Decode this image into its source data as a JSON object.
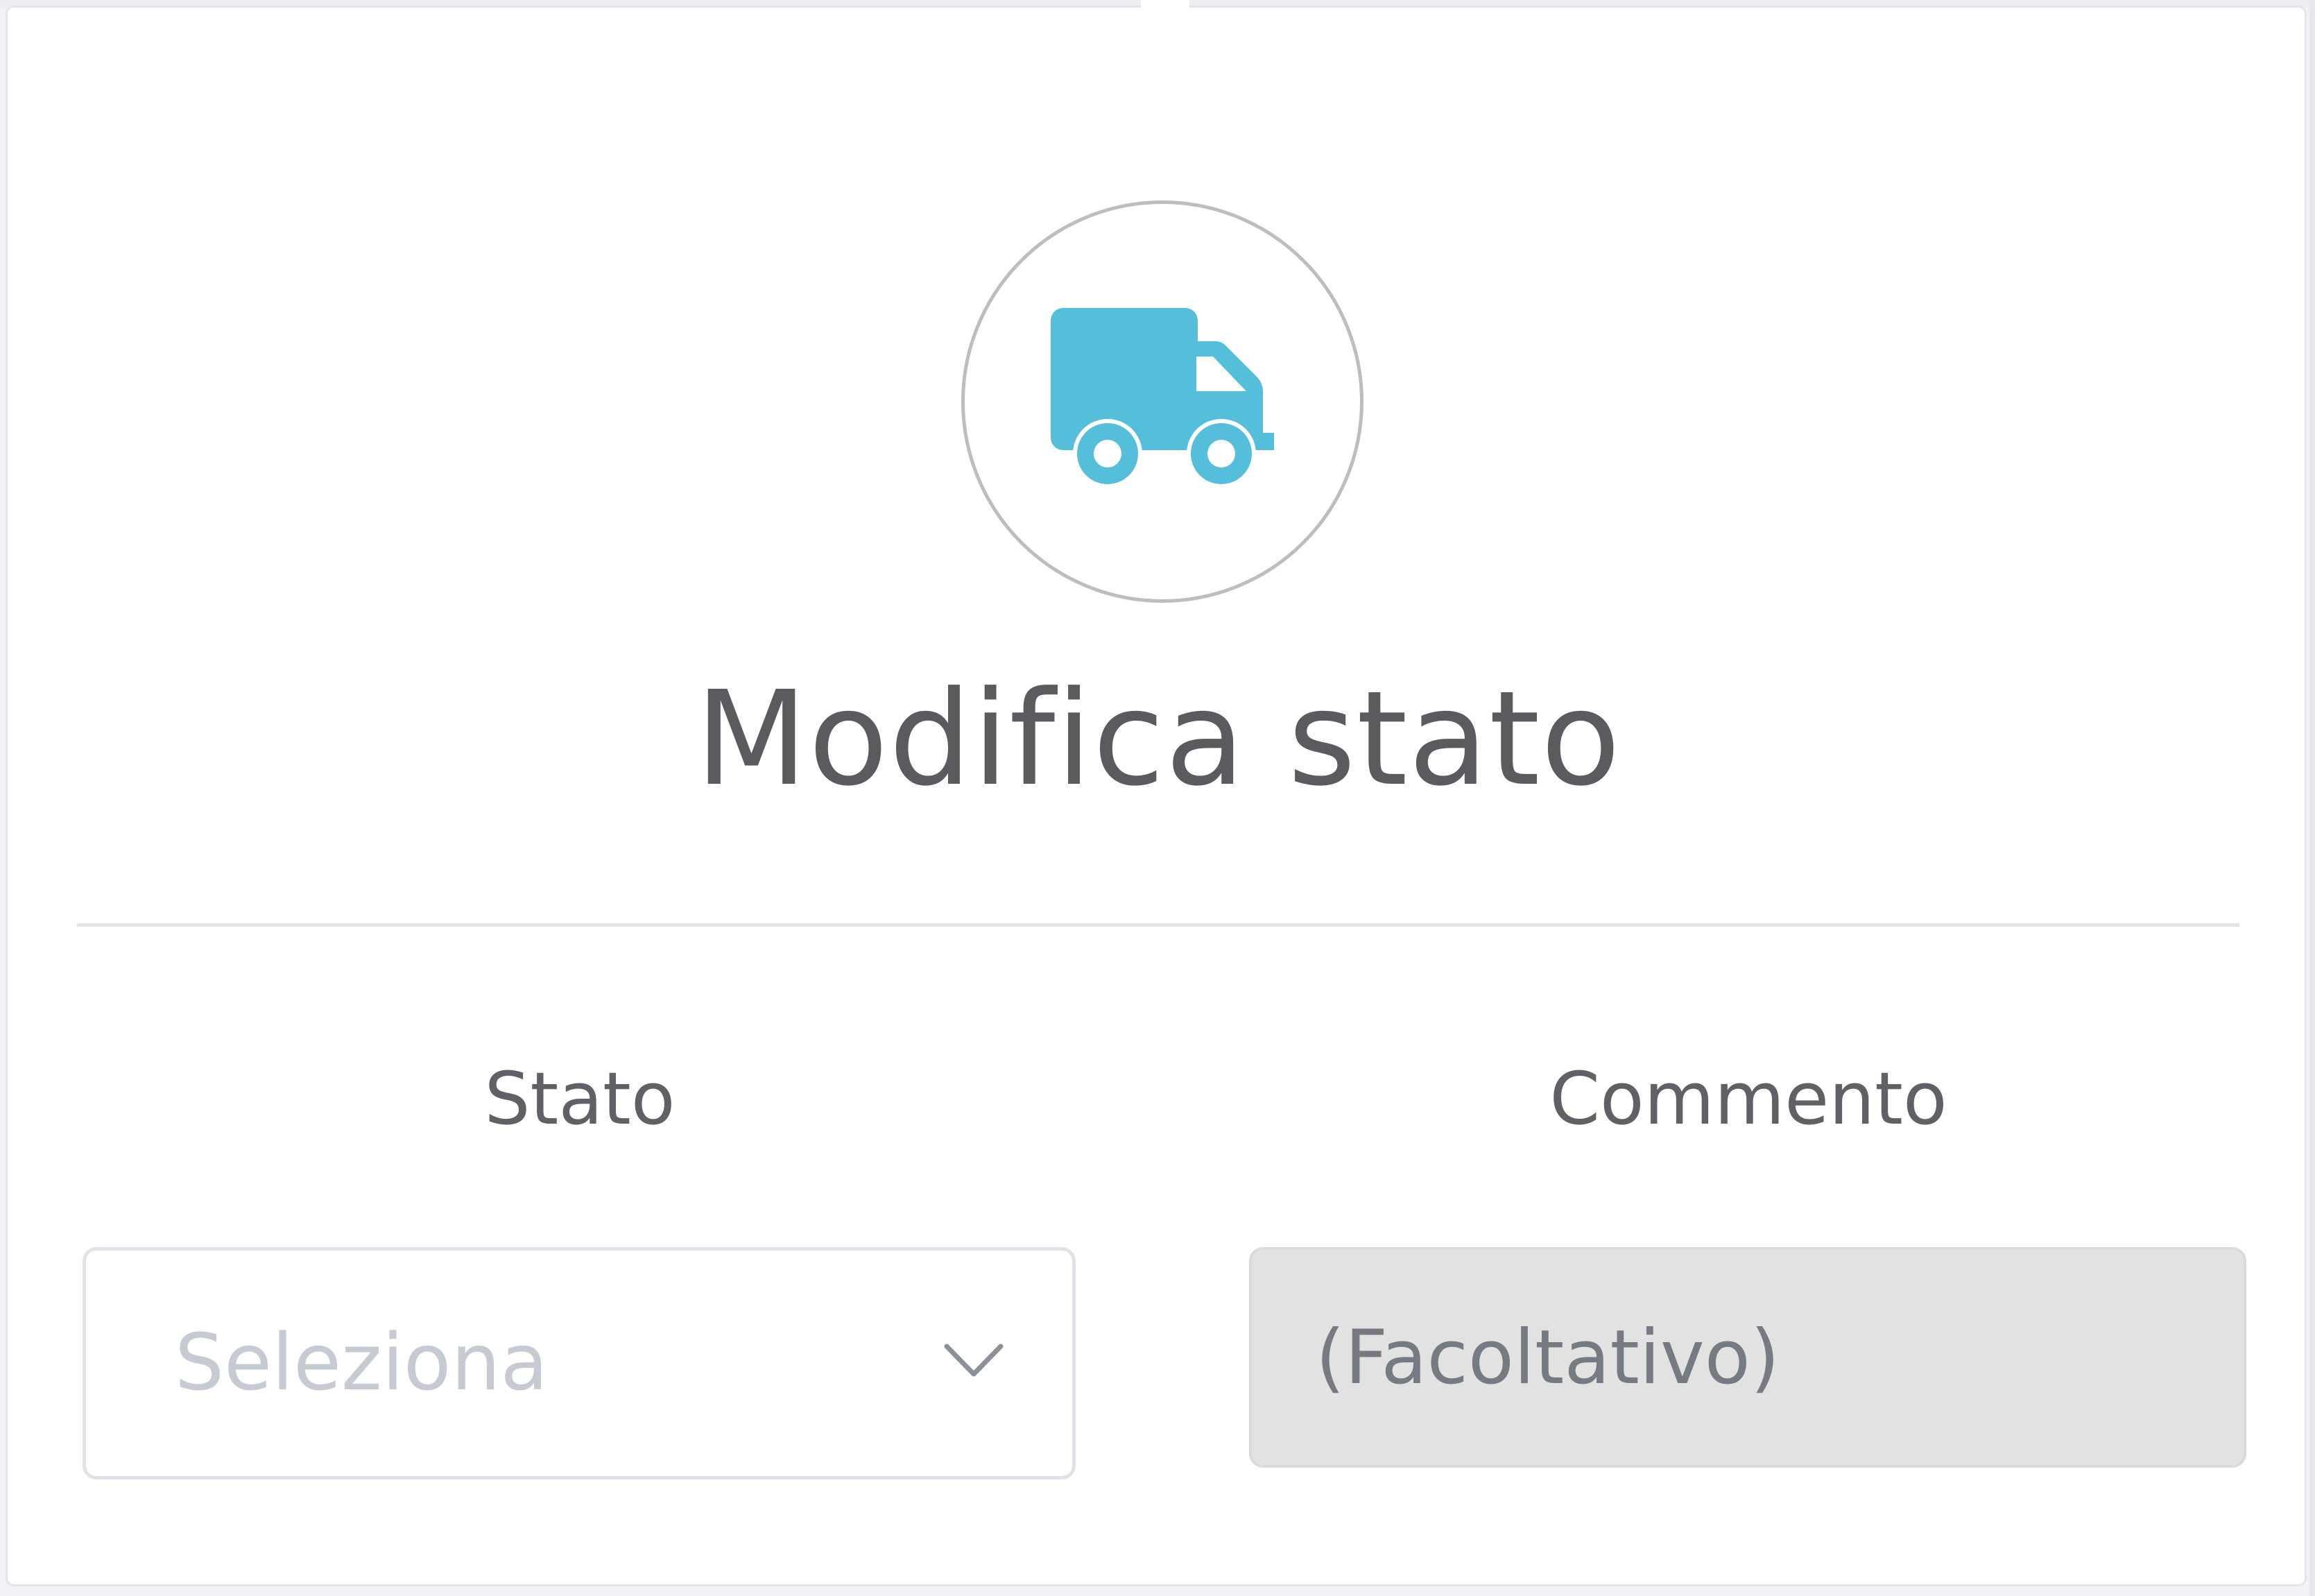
{
  "modal": {
    "title": "Modifica stato",
    "icon": "truck-icon",
    "icon_color": "#55bedb"
  },
  "form": {
    "stato": {
      "label": "Stato",
      "placeholder": "Seleziona"
    },
    "commento": {
      "label": "Commento",
      "placeholder": "(Facoltativo)"
    }
  }
}
